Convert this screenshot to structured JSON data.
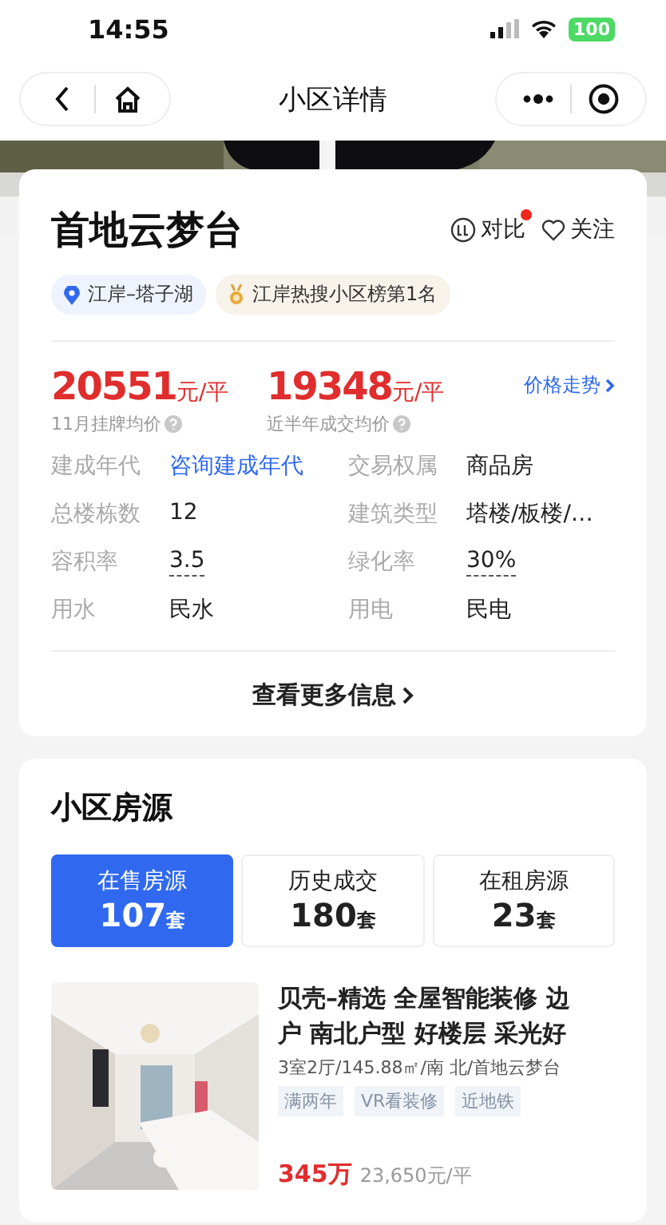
{
  "status_bar": {
    "time": "14:55",
    "battery": "100"
  },
  "nav": {
    "title": "小区详情"
  },
  "community": {
    "name": "首地云梦台",
    "compare": {
      "label": "对比",
      "has_new": true
    },
    "follow": {
      "label": "关注"
    },
    "tags": [
      {
        "kind": "location",
        "text": "江岸–塔子湖"
      },
      {
        "kind": "rank",
        "text": "江岸热搜小区榜第1名"
      }
    ]
  },
  "prices": [
    {
      "value": "20551",
      "unit": "元/平",
      "label": "11月挂牌均价"
    },
    {
      "value": "19348",
      "unit": "元/平",
      "label": "近半年成交均价"
    }
  ],
  "price_trend": "价格走势",
  "attributes": [
    {
      "label": "建成年代",
      "value": "咨询建成年代",
      "kind": "link"
    },
    {
      "label": "交易权属",
      "value": "商品房",
      "kind": "plain"
    },
    {
      "label": "总楼栋数",
      "value": "12",
      "kind": "plain"
    },
    {
      "label": "建筑类型",
      "value": "塔楼/板楼/…",
      "kind": "plain"
    },
    {
      "label": "容积率",
      "value": "3.5",
      "kind": "dotted"
    },
    {
      "label": "绿化率",
      "value": "30%",
      "kind": "dotted"
    },
    {
      "label": "用水",
      "value": "民水",
      "kind": "plain"
    },
    {
      "label": "用电",
      "value": "民电",
      "kind": "plain"
    }
  ],
  "more_info": "查看更多信息",
  "listings": {
    "title": "小区房源",
    "tabs": [
      {
        "label": "在售房源",
        "count": "107",
        "unit": "套",
        "selected": true
      },
      {
        "label": "历史成交",
        "count": "180",
        "unit": "套",
        "selected": false
      },
      {
        "label": "在租房源",
        "count": "23",
        "unit": "套",
        "selected": false
      }
    ],
    "item": {
      "kind": "picture",
      "title": "贝壳–精选 全屋智能装修 边户 南北户型 好楼层 采光好",
      "info": "3室2厅/145.88㎡/南 北/首地云梦台",
      "tags": [
        "满两年",
        "VR看装修",
        "近地铁"
      ],
      "price": "345万",
      "unit_price": "23,650元/平"
    }
  }
}
